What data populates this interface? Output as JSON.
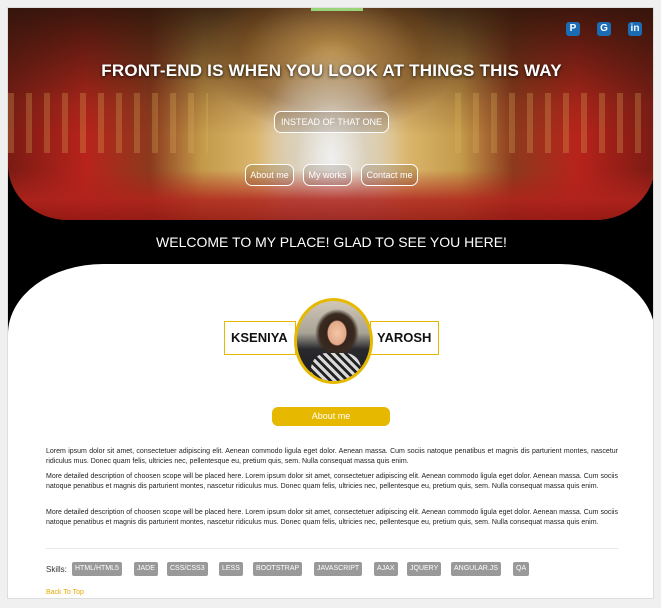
{
  "hero": {
    "title": "FRONT-END IS WHEN YOU LOOK AT THINGS THIS WAY",
    "subtitle_button": "INSTEAD OF THAT ONE",
    "nav": [
      {
        "label": "About me"
      },
      {
        "label": "My works"
      },
      {
        "label": "Contact me"
      }
    ],
    "social": [
      {
        "icon": "pinterest-icon",
        "glyph": "P"
      },
      {
        "icon": "github-icon",
        "glyph": "G"
      },
      {
        "icon": "linkedin-icon",
        "glyph": "in"
      }
    ]
  },
  "welcome": "WELCOME TO MY PLACE! GLAD TO SEE YOU HERE!",
  "profile": {
    "first_name": "KSENIYA",
    "last_name": "YAROSH",
    "about_button": "About me"
  },
  "about": {
    "paragraphs": [
      "Lorem ipsum dolor sit amet, consectetuer adipiscing elit. Aenean commodo ligula eget dolor. Aenean massa. Cum sociis natoque penatibus et magnis dis parturient montes, nascetur ridiculus mus. Donec quam felis, ultricies nec, pellentesque eu, pretium quis, sem. Nulla consequat massa quis enim.",
      "More detailed description of choosen scope will be placed here. Lorem ipsum dolor sit amet, consectetuer adipiscing elit. Aenean commodo ligula eget dolor. Aenean massa. Cum sociis natoque penatibus et magnis dis parturient montes, nascetur ridiculus mus. Donec quam felis, ultricies nec, pellentesque eu, pretium quis, sem. Nulla consequat massa quis enim.",
      "More detailed description of choosen scope will be placed here. Lorem ipsum dolor sit amet, consectetuer adipiscing elit. Aenean commodo ligula eget dolor. Aenean massa. Cum sociis natoque penatibus et magnis dis parturient montes, nascetur ridiculus mus. Donec quam felis, ultricies nec, pellentesque eu, pretium quis, sem. Nulla consequat massa quis enim."
    ]
  },
  "skills": {
    "label": "Skills:",
    "items": [
      "HTML/HTML5",
      "JADE",
      "CSS/CSS3",
      "LESS",
      "BOOTSTRAP",
      "JAVASCRIPT",
      "AJAX",
      "JQUERY",
      "ANGULAR.JS",
      "QA"
    ]
  },
  "footer": {
    "back_to_top": "Back To Top"
  },
  "colors": {
    "accent": "#e6b800",
    "social": "#1a6db5",
    "skill_tag": "#999999"
  }
}
